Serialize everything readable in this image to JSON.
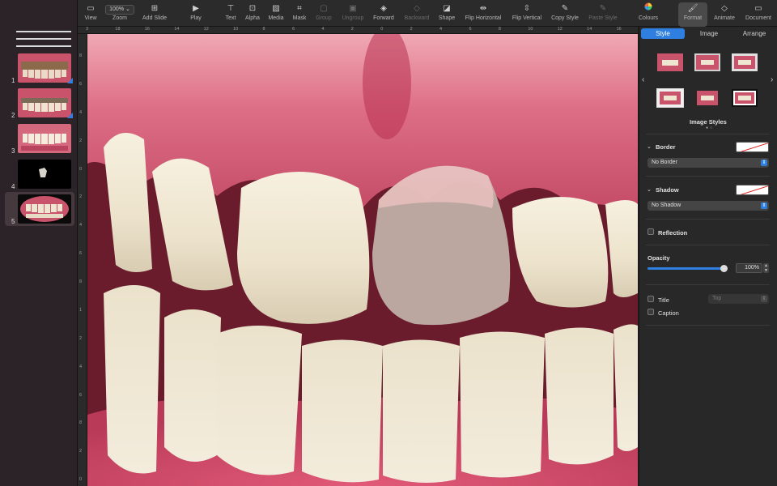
{
  "toolbar": {
    "view": "View",
    "zoom": "Zoom",
    "zoom_value": "100% ⌄",
    "add_slide": "Add Slide",
    "play": "Play",
    "text": "Text",
    "alpha": "Alpha",
    "media": "Media",
    "mask": "Mask",
    "group": "Group",
    "ungroup": "Ungroup",
    "forward": "Forward",
    "backward": "Backward",
    "shape": "Shape",
    "flip_horizontal": "Flip Horizontal",
    "flip_vertical": "Flip Vertical",
    "copy_style": "Copy Style",
    "paste_style": "Paste Style",
    "colours": "Colours",
    "format": "Format",
    "animate": "Animate",
    "document": "Document"
  },
  "slides": [
    {
      "number": "1"
    },
    {
      "number": "2"
    },
    {
      "number": "3"
    },
    {
      "number": "4"
    },
    {
      "number": "5"
    }
  ],
  "ruler": {
    "top": [
      "3",
      "18",
      "16",
      "14",
      "12",
      "10",
      "8",
      "6",
      "4",
      "2",
      "0",
      "2",
      "4",
      "6",
      "8",
      "10",
      "12",
      "14",
      "16"
    ],
    "left": [
      "8",
      "6",
      "4",
      "2",
      "0",
      "2",
      "4",
      "6",
      "8",
      "1",
      "2",
      "4",
      "6",
      "8",
      "2",
      "0"
    ]
  },
  "inspector": {
    "tabs": [
      "Style",
      "Image",
      "Arrange"
    ],
    "image_styles_label": "Image Styles",
    "border_label": "Border",
    "border_value": "No Border",
    "shadow_label": "Shadow",
    "shadow_value": "No Shadow",
    "reflection_label": "Reflection",
    "opacity_label": "Opacity",
    "opacity_value": "100%",
    "opacity_level": 1.0,
    "title_label": "Title",
    "title_position": "Top",
    "caption_label": "Caption"
  },
  "colors": {
    "accent": "#2f7fe0",
    "gum": "#d9607a",
    "tooth": "#efe6d2"
  }
}
